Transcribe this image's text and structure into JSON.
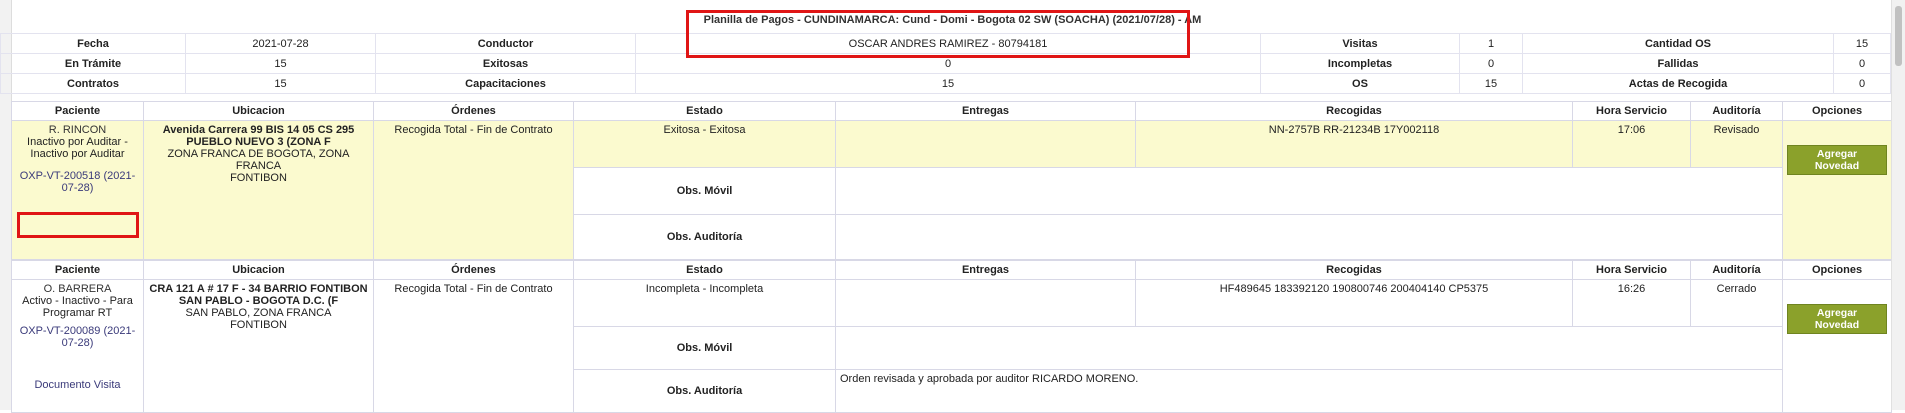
{
  "header": {
    "title": "Planilla de Pagos - CUNDINAMARCA: Cund - Domi - Bogota 02 SW (SOACHA) (2021/07/28) - AM"
  },
  "summary": {
    "row1": [
      "Fecha",
      "2021-07-28",
      "Conductor",
      "OSCAR ANDRES RAMIREZ - 80794181",
      "Visitas",
      "1",
      "Cantidad OS",
      "15"
    ],
    "row2": [
      "En Trámite",
      "15",
      "Exitosas",
      "0",
      "Incompletas",
      "0",
      "Fallidas",
      "0"
    ],
    "row3": [
      "Contratos",
      "15",
      "Capacitaciones",
      "15",
      "OS",
      "15",
      "Actas de Recogida",
      "0"
    ]
  },
  "columns": [
    "Paciente",
    "Ubicacion",
    "Órdenes",
    "Estado",
    "Entregas",
    "Recogidas",
    "Hora Servicio",
    "Auditoría",
    "Opciones"
  ],
  "records": [
    {
      "patient_name": "R. RINCON",
      "patient_status": "Inactivo por Auditar - Inactivo por Auditar",
      "patient_code": "OXP-VT-200518 (2021-07-28)",
      "address_bold": "Avenida Carrera 99 BIS 14 05 CS 295 PUEBLO NUEVO 3 (ZONA F",
      "address_rest": "ZONA FRANCA DE BOGOTA, ZONA FRANCA",
      "address_city": "FONTIBON",
      "orders": "Recogida Total - Fin de Contrato",
      "status": "Exitosa - Exitosa",
      "entregas": "",
      "recogidas": "NN-2757B RR-21234B 17Y002118",
      "hora": "17:06",
      "auditoria": "Revisado",
      "button": "Agregar Novedad",
      "obs_movil_label": "Obs. Móvil",
      "obs_movil": "",
      "obs_auditoria_label": "Obs. Auditoría",
      "obs_auditoria": ""
    },
    {
      "patient_name": "O. BARRERA",
      "patient_status": "Activo - Inactivo - Para Programar RT",
      "patient_code": "OXP-VT-200089 (2021-07-28)",
      "patient_doc": "Documento Visita",
      "address_bold": "CRA 121 A # 17 F - 34 BARRIO FONTIBON SAN PABLO - BOGOTA D.C. (F",
      "address_rest": "SAN PABLO, ZONA FRANCA",
      "address_city": "FONTIBON",
      "orders": "Recogida Total - Fin de Contrato",
      "status": "Incompleta - Incompleta",
      "entregas": "",
      "recogidas": "HF489645 183392120 190800746 200404140 CP5375",
      "hora": "16:26",
      "auditoria": "Cerrado",
      "button": "Agregar Novedad",
      "obs_movil_label": "Obs. Móvil",
      "obs_movil": "",
      "obs_auditoria_label": "Obs. Auditoría",
      "obs_auditoria": "Orden revisada y aprobada por auditor RICARDO MORENO."
    }
  ]
}
